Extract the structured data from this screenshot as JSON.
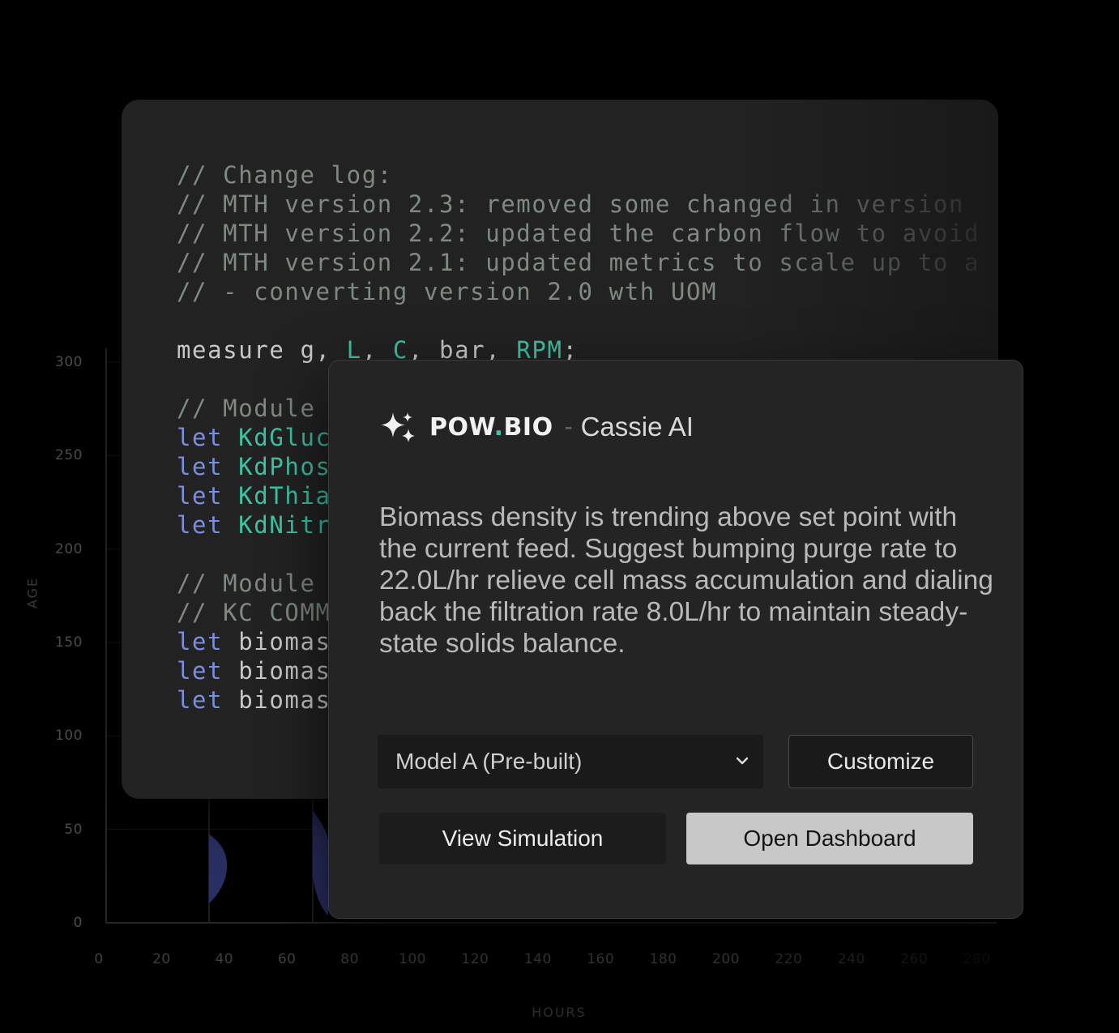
{
  "chart": {
    "y_axis_label": "AGE",
    "x_axis_label": "HOURS",
    "y_ticks": [
      "300",
      "250",
      "200",
      "150",
      "100",
      "50",
      "0"
    ],
    "x_ticks": [
      "0",
      "20",
      "40",
      "60",
      "80",
      "100",
      "120",
      "140",
      "160",
      "180",
      "200",
      "220",
      "240",
      "260",
      "280"
    ],
    "series_color": "#2a2f63"
  },
  "code": {
    "lines": [
      [
        {
          "t": "// Change log:",
          "c": "comment"
        }
      ],
      [
        {
          "t": "// MTH version 2.3: removed some changed in version",
          "c": "comment"
        }
      ],
      [
        {
          "t": "// MTH version 2.2: updated the carbon flow to avoid",
          "c": "comment"
        }
      ],
      [
        {
          "t": "// MTH version 2.1: updated metrics to scale up to a",
          "c": "comment"
        }
      ],
      [
        {
          "t": "// - converting version 2.0 wth UOM",
          "c": "comment"
        }
      ],
      [],
      [
        {
          "t": "measure g, ",
          "c": "plain"
        },
        {
          "t": "L",
          "c": "id"
        },
        {
          "t": ", ",
          "c": "plain"
        },
        {
          "t": "C",
          "c": "id"
        },
        {
          "t": ", bar, ",
          "c": "plain"
        },
        {
          "t": "RPM",
          "c": "id"
        },
        {
          "t": ";",
          "c": "plain"
        }
      ],
      [],
      [
        {
          "t": "// Module",
          "c": "comment"
        }
      ],
      [
        {
          "t": "let ",
          "c": "kw"
        },
        {
          "t": "KdGluc",
          "c": "id"
        }
      ],
      [
        {
          "t": "let ",
          "c": "kw"
        },
        {
          "t": "KdPhos",
          "c": "id"
        }
      ],
      [
        {
          "t": "let ",
          "c": "kw"
        },
        {
          "t": "KdThia",
          "c": "id"
        }
      ],
      [
        {
          "t": "let ",
          "c": "kw"
        },
        {
          "t": "KdNitr",
          "c": "id"
        }
      ],
      [],
      [
        {
          "t": "// Module",
          "c": "comment"
        }
      ],
      [
        {
          "t": "// KC COMM",
          "c": "comment"
        }
      ],
      [
        {
          "t": "let ",
          "c": "kw"
        },
        {
          "t": "biomas",
          "c": "plain"
        }
      ],
      [
        {
          "t": "let ",
          "c": "kw"
        },
        {
          "t": "biomas",
          "c": "plain"
        }
      ],
      [
        {
          "t": "let ",
          "c": "kw"
        },
        {
          "t": "biomas",
          "c": "plain"
        }
      ]
    ],
    "colors": {
      "comment": "#7e8a80",
      "kw": "#7a8fe0",
      "id": "#3cc4a5",
      "plain": "#c8c8c8"
    }
  },
  "dialog": {
    "brand_main": "POW",
    "brand_dot": ".",
    "brand_suffix": "BIO",
    "brand_sep": "-",
    "product": "Cassie AI",
    "message": "Biomass density is trending above set point with the current feed. Suggest bumping purge rate to 22.0L/hr relieve cell mass accumulation and dialing back the filtration rate 8.0L/hr to maintain steady-state solids balance.",
    "model_select_value": "Model A (Pre-built)",
    "customize_label": "Customize",
    "view_simulation_label": "View Simulation",
    "open_dashboard_label": "Open Dashboard",
    "accent_color": "#3cc4a5",
    "icon": "sparkle-icon"
  }
}
